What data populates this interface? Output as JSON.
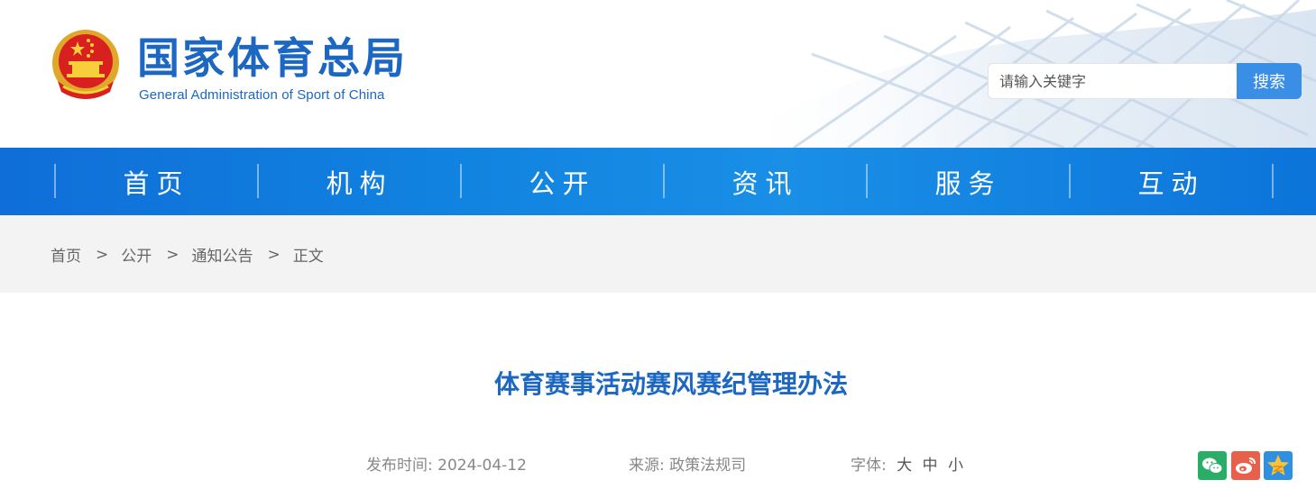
{
  "header": {
    "title_cn": "国家体育总局",
    "title_en": "General Administration of Sport of China",
    "emblem_icon": "national-emblem-icon"
  },
  "search": {
    "placeholder": "请输入关键字",
    "value": "",
    "button_label": "搜索"
  },
  "nav": {
    "items": [
      "首页",
      "机构",
      "公开",
      "资讯",
      "服务",
      "互动"
    ]
  },
  "breadcrumb": {
    "items": [
      "首页",
      "公开",
      "通知公告",
      "正文"
    ],
    "separator": ">"
  },
  "article": {
    "title": "体育赛事活动赛风赛纪管理办法",
    "publish_label": "发布时间:",
    "publish_date": "2024-04-12",
    "source_label": "来源:",
    "source": "政策法规司",
    "font_label": "字体:",
    "font_sizes": [
      "大",
      "中",
      "小"
    ]
  },
  "share": {
    "icons": [
      "wechat-icon",
      "weibo-icon",
      "qzone-icon"
    ]
  },
  "colors": {
    "brand_blue": "#1b67c2",
    "nav_blue": "#1183e0",
    "search_button": "#3a8ee6",
    "wechat_green": "#2aae67",
    "weibo_red": "#e8604c",
    "qzone_blue": "#2f8fe0"
  }
}
